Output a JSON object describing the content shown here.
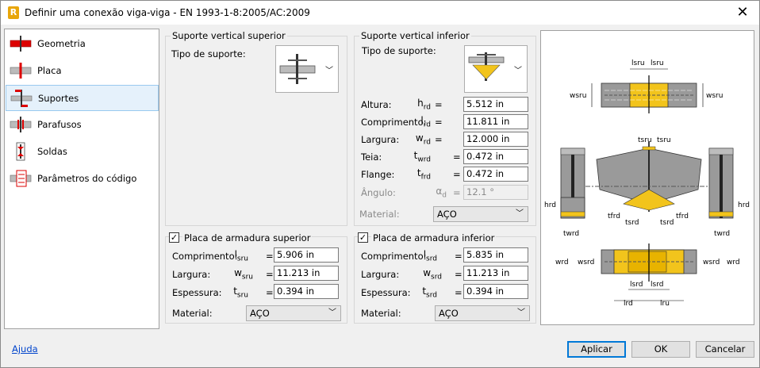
{
  "window": {
    "title": "Definir uma conexão viga-viga - EN 1993-1-8:2005/AC:2009",
    "app_icon": "R",
    "close": "✕"
  },
  "sidebar": {
    "items": [
      {
        "label": "Geometria"
      },
      {
        "label": "Placa"
      },
      {
        "label": "Suportes"
      },
      {
        "label": "Parafusos"
      },
      {
        "label": "Soldas"
      },
      {
        "label": "Parâmetros do código"
      }
    ],
    "selected": "Suportes"
  },
  "upper_support": {
    "title": "Suporte vertical superior",
    "type_label": "Tipo de suporte:"
  },
  "lower_support": {
    "title": "Suporte vertical inferior",
    "type_label": "Tipo de suporte:",
    "rows": [
      {
        "label": "Altura:",
        "sym": "h",
        "sub": "rd",
        "value": "5.512 in"
      },
      {
        "label": "Comprimento:",
        "sym": "l",
        "sub": "rd",
        "value": "11.811 in"
      },
      {
        "label": "Largura:",
        "sym": "w",
        "sub": "rd",
        "value": "12.000 in"
      },
      {
        "label": "Teia:",
        "sym": "t",
        "sub": "wrd",
        "value": "0.472 in"
      },
      {
        "label": "Flange:",
        "sym": "t",
        "sub": "frd",
        "value": "0.472 in"
      },
      {
        "label": "Ângulo:",
        "sym": "α",
        "sub": "d",
        "value": "12.1 °"
      }
    ],
    "material_label": "Material:",
    "material": "AÇO"
  },
  "upper_plate": {
    "title": "Placa de armadura superior",
    "checked": true,
    "rows": [
      {
        "label": "Comprimento:",
        "sym": "l",
        "sub": "sru",
        "value": "5.906 in"
      },
      {
        "label": "Largura:",
        "sym": "w",
        "sub": "sru",
        "value": "11.213 in"
      },
      {
        "label": "Espessura:",
        "sym": "t",
        "sub": "sru",
        "value": "0.394 in"
      }
    ],
    "material_label": "Material:",
    "material": "AÇO"
  },
  "lower_plate": {
    "title": "Placa de armadura inferior",
    "checked": true,
    "rows": [
      {
        "label": "Comprimento:",
        "sym": "l",
        "sub": "srd",
        "value": "5.835 in"
      },
      {
        "label": "Largura:",
        "sym": "w",
        "sub": "srd",
        "value": "11.213 in"
      },
      {
        "label": "Espessura:",
        "sym": "t",
        "sub": "srd",
        "value": "0.394 in"
      }
    ],
    "material_label": "Material:",
    "material": "AÇO"
  },
  "diagram_labels": {
    "lsru": "lsru",
    "wsru": "wsru",
    "tsru": "tsru",
    "hrd": "hrd",
    "twrd": "twrd",
    "tfrd": "tfrd",
    "tsrd": "tsrd",
    "wrd": "wrd",
    "wsrd": "wsrd",
    "lsrd": "lsrd",
    "lrd": "lrd",
    "lru": "lru"
  },
  "footer": {
    "help": "Ajuda",
    "apply": "Aplicar",
    "ok": "OK",
    "cancel": "Cancelar"
  },
  "colors": {
    "steel": "#8c8c8c",
    "plate": "#f2c41c",
    "selected": "#e5f1fb",
    "accent": "#0078d7"
  }
}
